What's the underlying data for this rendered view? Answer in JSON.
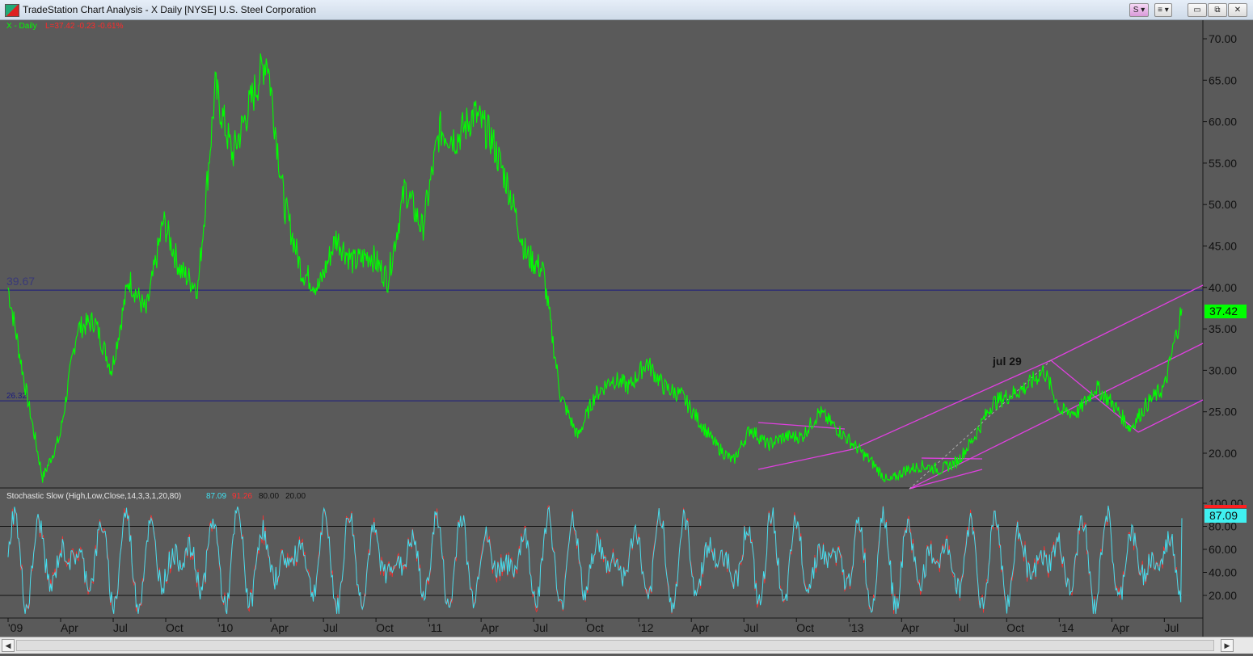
{
  "window": {
    "title": "TradeStation Chart Analysis - X Daily [NYSE] U.S. Steel Corporation",
    "symbol_button": "S ▾",
    "menu_button": "≡ ▾",
    "minimize": "▭",
    "maximize": "⧉",
    "close": "✕"
  },
  "chart": {
    "symbol_label": "X - Daily",
    "quote_label": "L=37.42  -0.23  -0.61%",
    "price_ticks": [
      "70.00",
      "65.00",
      "60.00",
      "55.00",
      "50.00",
      "45.00",
      "40.00",
      "35.00",
      "30.00",
      "25.00",
      "20.00"
    ],
    "last_price": "37.42",
    "level_39": "39.67",
    "level_26": "26.32",
    "annotation": "jul 29",
    "date_ticks": [
      "'09",
      "Apr",
      "Jul",
      "Oct",
      "'10",
      "Apr",
      "Jul",
      "Oct",
      "'11",
      "Apr",
      "Jul",
      "Oct",
      "'12",
      "Apr",
      "Jul",
      "Oct",
      "'13",
      "Apr",
      "Jul",
      "Oct",
      "'14",
      "Apr",
      "Jul"
    ],
    "colors": {
      "background": "#5a5a5a",
      "price": "#00ff00",
      "trendline": "#e040e0",
      "stoch_k": "#40e0f0",
      "stoch_d": "#ff3030",
      "level_line": "#1a1a80"
    }
  },
  "stochastic": {
    "label": "Stochastic Slow (High,Low,Close,14,3,3,1,20,80)",
    "k_value": "87.09",
    "d_value": "91.26",
    "overbought": "80.00",
    "oversold": "20.00",
    "ticks": [
      "100.00",
      "80.00",
      "60.00",
      "40.00",
      "20.00"
    ],
    "last_k": "87.09"
  },
  "chart_data": {
    "type": "line",
    "title": "X - Daily",
    "x": [
      "2009-01",
      "2009-02",
      "2009-03",
      "2009-04",
      "2009-05",
      "2009-06",
      "2009-07",
      "2009-08",
      "2009-09",
      "2009-10",
      "2009-11",
      "2009-12",
      "2010-01",
      "2010-02",
      "2010-03",
      "2010-04",
      "2010-05",
      "2010-06",
      "2010-07",
      "2010-08",
      "2010-09",
      "2010-10",
      "2010-11",
      "2010-12",
      "2011-01",
      "2011-02",
      "2011-03",
      "2011-04",
      "2011-05",
      "2011-06",
      "2011-07",
      "2011-08",
      "2011-09",
      "2011-10",
      "2011-11",
      "2011-12",
      "2012-01",
      "2012-02",
      "2012-03",
      "2012-04",
      "2012-05",
      "2012-06",
      "2012-07",
      "2012-08",
      "2012-09",
      "2012-10",
      "2012-11",
      "2012-12",
      "2013-01",
      "2013-02",
      "2013-03",
      "2013-04",
      "2013-05",
      "2013-06",
      "2013-07",
      "2013-08",
      "2013-09",
      "2013-10",
      "2013-11",
      "2013-12",
      "2014-01",
      "2014-02",
      "2014-03",
      "2014-04",
      "2014-05",
      "2014-06",
      "2014-07",
      "2014-08"
    ],
    "series": [
      {
        "values": [
          40,
          28,
          17,
          22,
          35,
          36,
          30,
          41,
          37,
          48,
          42,
          40,
          64,
          56,
          62,
          68,
          50,
          42,
          40,
          46,
          43,
          44,
          41,
          52,
          47,
          59,
          58,
          61,
          58,
          52,
          44,
          42,
          27,
          22,
          27,
          29,
          28,
          31,
          28,
          27,
          24,
          21,
          19,
          23,
          21,
          22,
          22,
          25,
          23,
          21,
          19,
          16.5,
          18,
          18.5,
          18,
          19,
          22,
          26,
          27,
          28,
          30,
          25,
          25,
          28,
          26,
          23,
          26,
          28,
          37.42
        ]
      }
    ],
    "ylim": [
      15,
      72
    ],
    "horizontal_levels": [
      39.67,
      26.32
    ],
    "stochastic": {
      "k": 87.09,
      "d": 91.26,
      "overbought": 80,
      "oversold": 20,
      "ylim": [
        0,
        100
      ]
    }
  }
}
